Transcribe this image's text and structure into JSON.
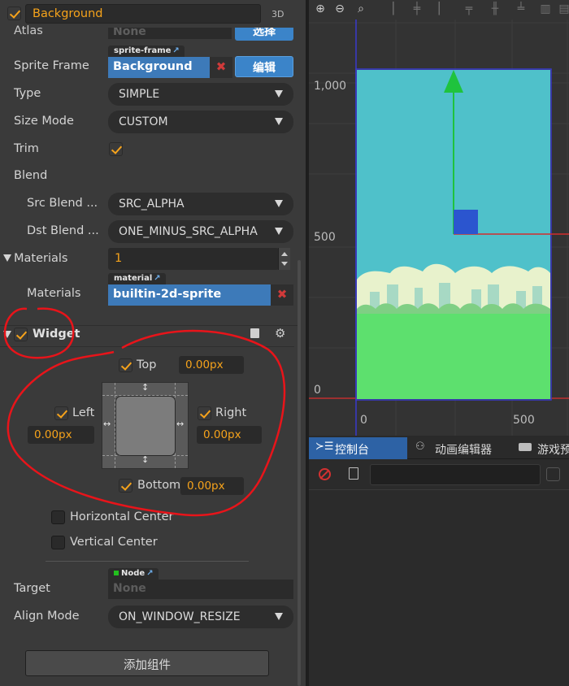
{
  "header": {
    "node_name": "Background",
    "mode_label": "3D"
  },
  "sprite": {
    "atlas_label": "Atlas",
    "atlas_value": "None",
    "atlas_button": "选择",
    "sprite_frame_label": "Sprite Frame",
    "sprite_frame_tag": "sprite-frame",
    "sprite_frame_value": "Background",
    "edit_button": "编辑",
    "remove_glyph": "✖",
    "type_label": "Type",
    "type_value": "SIMPLE",
    "size_mode_label": "Size Mode",
    "size_mode_value": "CUSTOM",
    "trim_label": "Trim",
    "blend_label": "Blend",
    "src_blend_label": "Src Blend ...",
    "src_blend_value": "SRC_ALPHA",
    "dst_blend_label": "Dst Blend ...",
    "dst_blend_value": "ONE_MINUS_SRC_ALPHA",
    "materials_label": "Materials",
    "materials_count": "1",
    "material_item_label": "Materials",
    "material_tag": "material",
    "material_value": "builtin-2d-sprite"
  },
  "widget": {
    "title": "Widget",
    "top_label": "Top",
    "top_value": "0.00px",
    "left_label": "Left",
    "left_value": "0.00px",
    "right_label": "Right",
    "right_value": "0.00px",
    "bottom_label": "Bottom",
    "bottom_value": "0.00px",
    "horizontal_center_label": "Horizontal Center",
    "vertical_center_label": "Vertical Center",
    "target_label": "Target",
    "target_tag": "Node",
    "target_value": "None",
    "align_mode_label": "Align Mode",
    "align_mode_value": "ON_WINDOW_RESIZE"
  },
  "add_component_button": "添加组件",
  "scene": {
    "y_tick_1000": "1,000",
    "y_tick_500": "500",
    "y_tick_0": "0",
    "x_tick_0": "0",
    "x_tick_500": "500"
  },
  "console": {
    "tab_console": "控制台",
    "tab_animation": "动画编辑器",
    "tab_game": "游戏预"
  },
  "colors": {
    "accent": "#f6a31b",
    "asset_blue": "#3d7ab9",
    "annotation_red": "#e8141a"
  }
}
